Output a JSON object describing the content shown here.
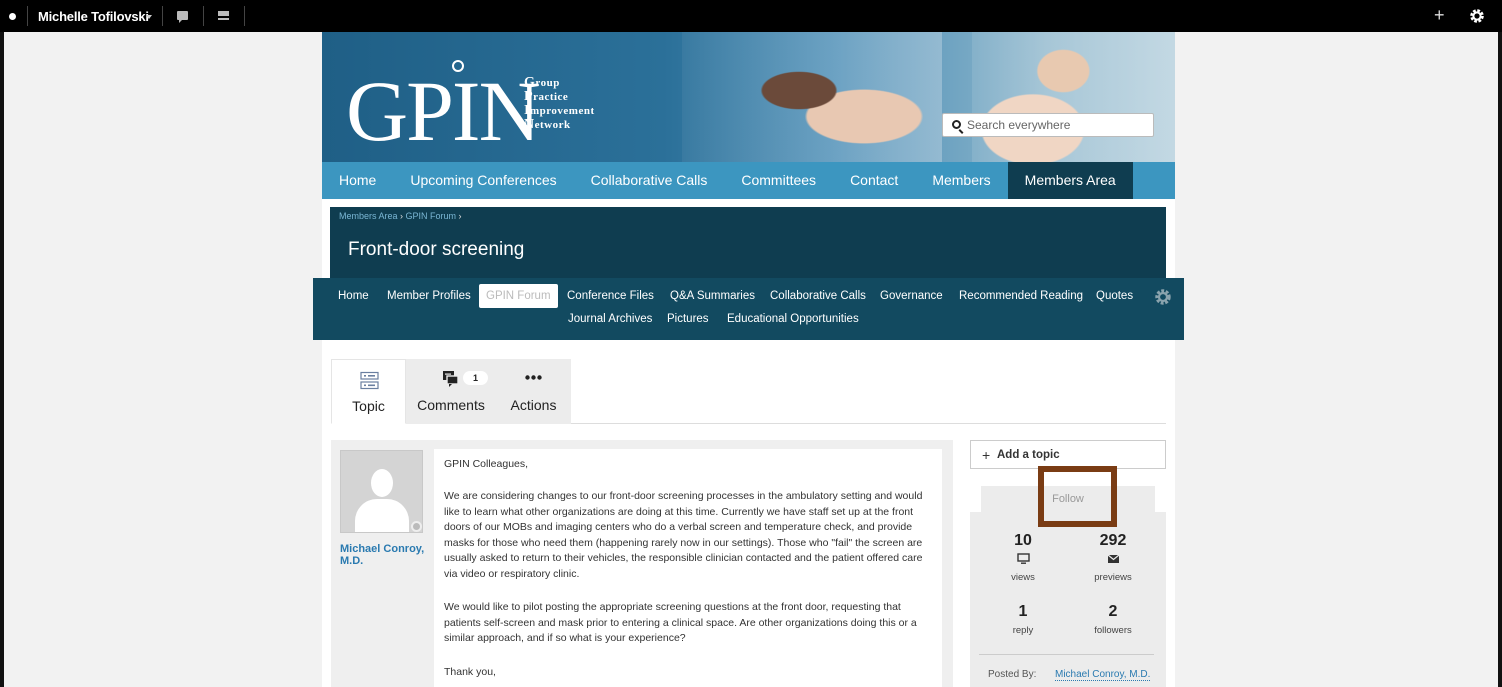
{
  "adminbar": {
    "user_name": "Michelle Tofilovski",
    "plus_label": "+"
  },
  "brand": {
    "logo_text": "GPIN",
    "tagline": [
      "Group",
      "Practice",
      "Improvement",
      "Network"
    ]
  },
  "search": {
    "placeholder": "Search everywhere"
  },
  "main_nav": {
    "items": [
      {
        "label": "Home"
      },
      {
        "label": "Upcoming Conferences"
      },
      {
        "label": "Collaborative Calls"
      },
      {
        "label": "Committees"
      },
      {
        "label": "Contact"
      },
      {
        "label": "Members"
      },
      {
        "label": "Members Area",
        "active": true
      }
    ]
  },
  "breadcrumb": {
    "items": [
      "Members Area",
      "GPIN Forum"
    ]
  },
  "page_title": "Front-door screening",
  "sub_nav": {
    "row1": [
      "Home",
      "Member Profiles",
      "GPIN Forum",
      "Conference Files",
      "Q&A Summaries",
      "Collaborative Calls",
      "Governance",
      "Recommended Reading",
      "Quotes"
    ],
    "row2": [
      "Journal Archives",
      "Pictures",
      "Educational Opportunities"
    ],
    "active": "GPIN Forum"
  },
  "tabs": {
    "topic": "Topic",
    "comments": "Comments",
    "comments_count": "1",
    "actions": "Actions"
  },
  "post": {
    "author": "Michael Conroy, M.D.",
    "paragraphs": [
      "GPIN Colleagues,",
      "We are considering changes to our front-door screening processes in the ambulatory setting and would like to learn what other organizations are doing at this time. Currently we have staff set up at the front doors of our MOBs and imaging centers who do a verbal screen and temperature check, and provide masks for those who need them (happening rarely now in our settings). Those who \"fail\" the screen are usually asked to return to their vehicles, the responsible clinician contacted and the patient offered care via video or respiratory clinic.",
      "We would like to pilot posting the appropriate screening questions at the front door, requesting that patients self-screen and mask prior to entering a clinical space. Are other organizations doing this or a similar approach, and if so what is your experience?",
      "Thank you,"
    ]
  },
  "sidebar": {
    "add_topic": "Add a topic",
    "follow": "Follow",
    "stats": {
      "views": {
        "num": "10",
        "label": "views"
      },
      "previews": {
        "num": "292",
        "label": "previews"
      },
      "reply": {
        "num": "1",
        "label": "reply"
      },
      "followers": {
        "num": "2",
        "label": "followers"
      }
    },
    "posted_by_label": "Posted By:",
    "posted_by_name": "Michael Conroy, M.D."
  },
  "colors": {
    "nav_blue": "#3c96c0",
    "dark_teal": "#0f3d50",
    "subnav_teal": "#124a60",
    "highlight_brown": "#7a3c14",
    "link_blue": "#2a7ab0"
  }
}
